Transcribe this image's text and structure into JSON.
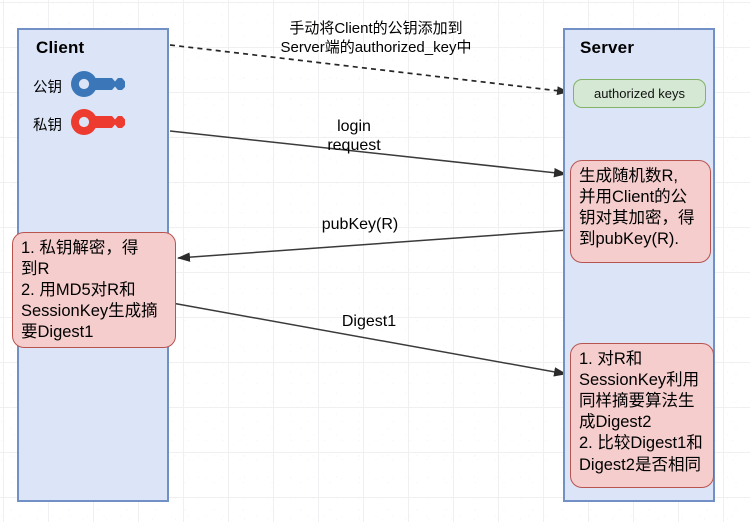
{
  "diagram": {
    "title_note": "手动将Client的公钥添加到\nServer端的authorized_key中",
    "client": {
      "title": "Client",
      "keys": [
        {
          "label": "公钥",
          "icon": "key-icon",
          "color": "#3b77b8"
        },
        {
          "label": "私钥",
          "icon": "key-icon",
          "color": "#ed3b30"
        }
      ],
      "note": "1. 私钥解密，得\n到R\n2. 用MD5对R和\nSessionKey生成摘\n要Digest1"
    },
    "server": {
      "title": "Server",
      "authorized_keys_label": "authorized keys",
      "note1": "生成随机数R,\n并用Client的公\n钥对其加密，得\n到pubKey(R).",
      "note2": "1. 对R和\nSessionKey利用\n同样摘要算法生\n成Digest2\n2. 比较Digest1和\nDigest2是否相同"
    },
    "messages": [
      {
        "label": "login\nrequest",
        "from": "client",
        "to": "server"
      },
      {
        "label": "pubKey(R)",
        "from": "server",
        "to": "client"
      },
      {
        "label": "Digest1",
        "from": "client",
        "to": "server"
      }
    ],
    "colors": {
      "lifeline_fill": "#dce4f7",
      "lifeline_border": "#7191c6",
      "note_fill": "#f5cdcd",
      "note_border": "#b85450",
      "authorized_fill": "#d5e8d4",
      "authorized_border": "#82b366",
      "public_key": "#3b77b8",
      "private_key": "#ed3b30",
      "line": "#3a3a3a"
    }
  }
}
